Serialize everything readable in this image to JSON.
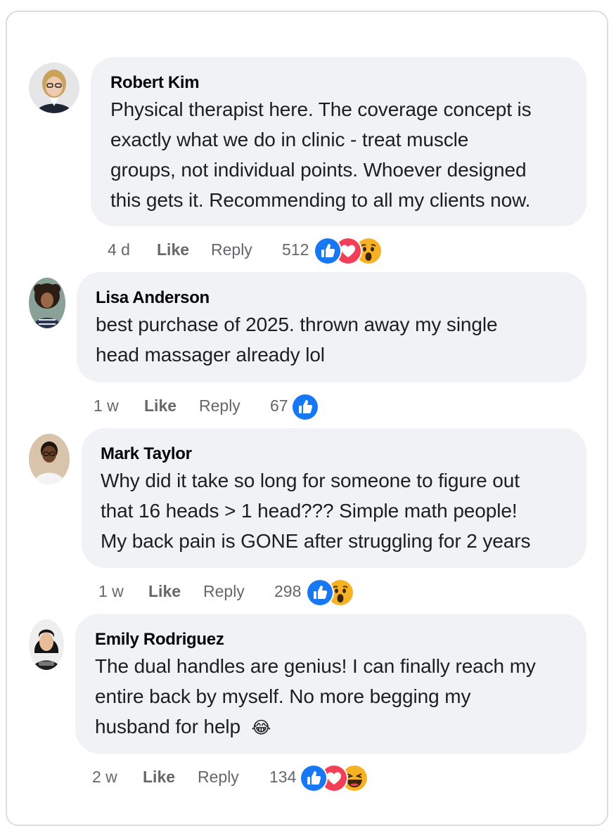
{
  "comments": [
    {
      "author": "Robert Kim",
      "lines": [
        "Physical therapist here. The coverage concept is",
        "exactly what we do in clinic - treat muscle",
        "groups, not individual points. Whoever designed",
        "this gets it. Recommending to all my clients now."
      ],
      "time": "4 d",
      "like_label": "Like",
      "reply_label": "Reply",
      "reaction_count": "512",
      "reactions": [
        "like-reaction",
        "love-reaction",
        "wow-reaction"
      ]
    },
    {
      "author": "Lisa Anderson",
      "lines": [
        "best purchase of 2025. thrown away my single",
        "head massager already lol"
      ],
      "time": "1 w",
      "like_label": "Like",
      "reply_label": "Reply",
      "reaction_count": "67",
      "reactions": [
        "like-reaction"
      ]
    },
    {
      "author": "Mark Taylor",
      "lines": [
        "Why did it take so long for someone to figure out",
        "that 16 heads > 1 head??? Simple math people!",
        "My back pain is GONE after struggling for 2 years"
      ],
      "time": "1 w",
      "like_label": "Like",
      "reply_label": "Reply",
      "reaction_count": "298",
      "reactions": [
        "like-reaction",
        "wow-reaction"
      ]
    },
    {
      "author": "Emily Rodriguez",
      "lines": [
        "The dual handles are genius! I can finally reach my",
        "entire back by myself. No more begging my",
        "husband for help"
      ],
      "emoji": "😂",
      "time": "2 w",
      "like_label": "Like",
      "reply_label": "Reply",
      "reaction_count": "134",
      "reactions": [
        "like-reaction",
        "love-reaction",
        "haha-reaction"
      ]
    }
  ],
  "colors": {
    "bubble": "#f0f2f5",
    "like_blue": "#1877f2",
    "love_red": "#f33e58",
    "wow_yellow": "#f7b125",
    "meta_gray": "#65676b"
  }
}
